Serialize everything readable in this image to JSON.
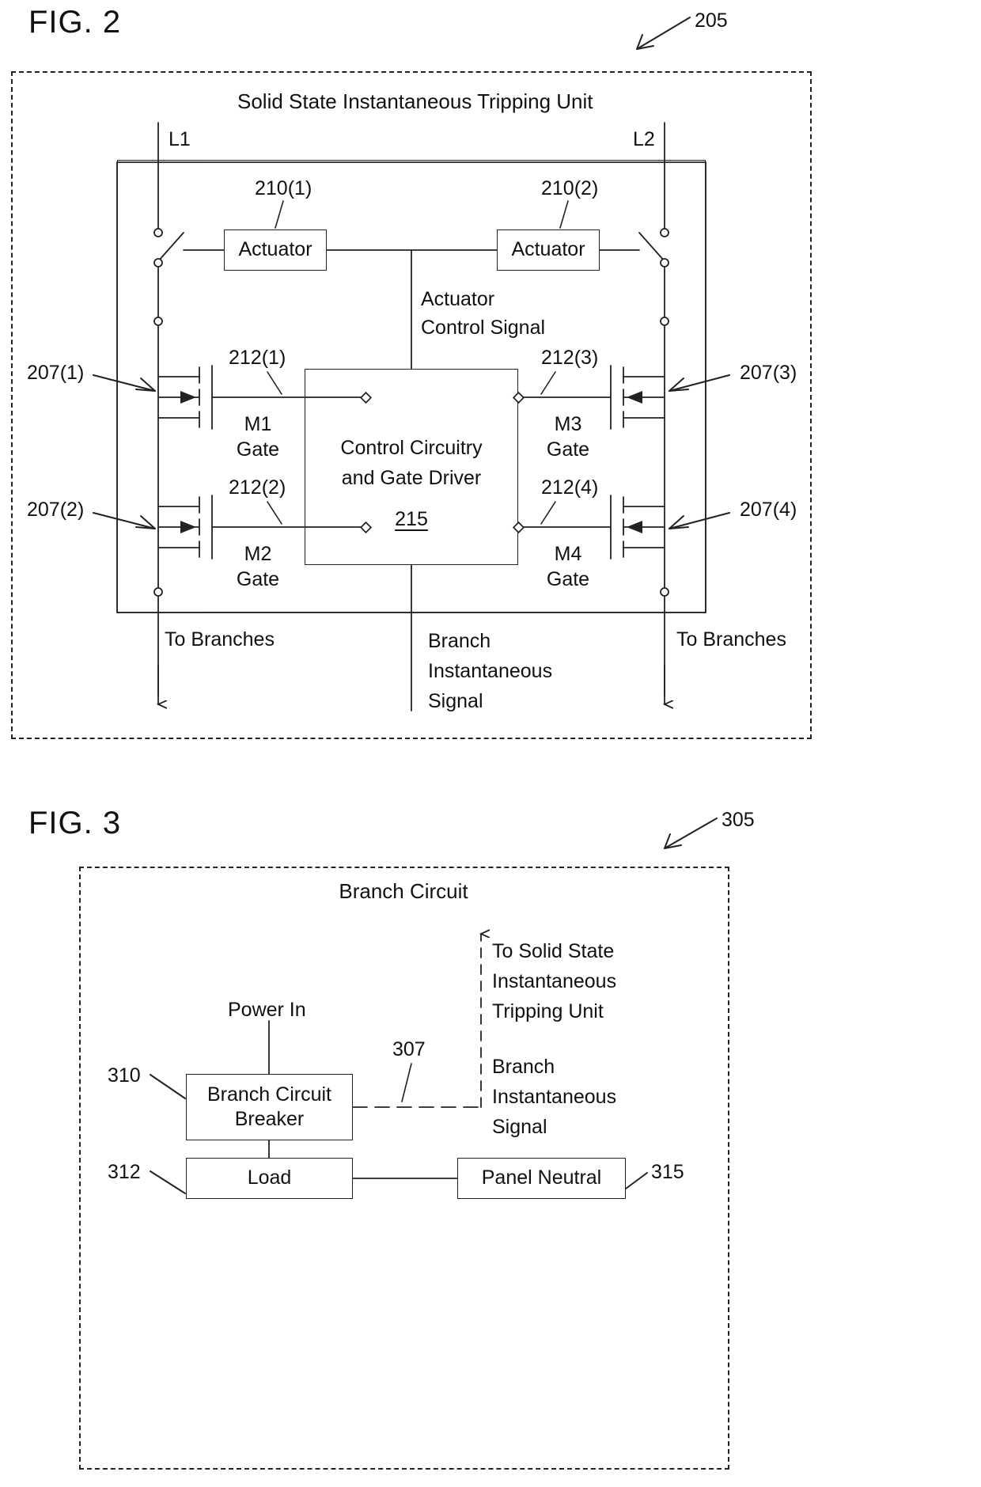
{
  "figures": [
    {
      "label": "FIG. 2",
      "ref_number": "205",
      "title": "Solid State Instantaneous Tripping Unit",
      "line_labels": {
        "left": "L1",
        "right": "L2"
      },
      "actuators": [
        {
          "ref": "210(1)",
          "label": "Actuator"
        },
        {
          "ref": "210(2)",
          "label": "Actuator"
        }
      ],
      "actuator_signal_label": "Actuator\nControl Signal",
      "control_block": {
        "line1": "Control Circuitry",
        "line2": "and Gate Driver",
        "ref": "215"
      },
      "mosfets": [
        {
          "ref": "207(1)",
          "gate_ref": "212(1)",
          "gate_label": "M1\nGate",
          "side": "left"
        },
        {
          "ref": "207(2)",
          "gate_ref": "212(2)",
          "gate_label": "M2\nGate",
          "side": "left"
        },
        {
          "ref": "207(3)",
          "gate_ref": "212(3)",
          "gate_label": "M3\nGate",
          "side": "right"
        },
        {
          "ref": "207(4)",
          "gate_ref": "212(4)",
          "gate_label": "M4\nGate",
          "side": "right"
        }
      ],
      "bottom_labels": {
        "left_branches": "To Branches",
        "right_branches": "To Branches",
        "branch_signal": "Branch\nInstantaneous\nSignal"
      }
    },
    {
      "label": "FIG. 3",
      "ref_number": "305",
      "title": "Branch Circuit",
      "power_in_label": "Power In",
      "to_unit_label": "To Solid State\nInstantaneous\nTripping Unit",
      "branch_signal_label": "Branch\nInstantaneous\nSignal",
      "signal_ref": "307",
      "blocks": [
        {
          "ref": "310",
          "label": "Branch Circuit\nBreaker"
        },
        {
          "ref": "312",
          "label": "Load"
        },
        {
          "ref": "315",
          "label": "Panel Neutral"
        }
      ]
    }
  ],
  "fig2": {
    "label": "FIG. 2",
    "ref": "205",
    "title": "Solid State Instantaneous Tripping Unit",
    "l1": "L1",
    "l2": "L2",
    "ref_210_1": "210(1)",
    "ref_210_2": "210(2)",
    "actuator1": "Actuator",
    "actuator2": "Actuator",
    "actuator_signal_l1": "Actuator",
    "actuator_signal_l2": "Control Signal",
    "ref_212_1": "212(1)",
    "ref_212_2": "212(2)",
    "ref_212_3": "212(3)",
    "ref_212_4": "212(4)",
    "ref_207_1": "207(1)",
    "ref_207_2": "207(2)",
    "ref_207_3": "207(3)",
    "ref_207_4": "207(4)",
    "m1_gate_a": "M1",
    "m1_gate_b": "Gate",
    "m2_gate_a": "M2",
    "m2_gate_b": "Gate",
    "m3_gate_a": "M3",
    "m3_gate_b": "Gate",
    "m4_gate_a": "M4",
    "m4_gate_b": "Gate",
    "control_l1": "Control Circuitry",
    "control_l2": "and Gate Driver",
    "control_ref": "215",
    "to_branches_left": "To Branches",
    "to_branches_right": "To Branches",
    "branch_sig_l1": "Branch",
    "branch_sig_l2": "Instantaneous",
    "branch_sig_l3": "Signal"
  },
  "fig3": {
    "label": "FIG. 3",
    "ref": "305",
    "title": "Branch Circuit",
    "power_in": "Power In",
    "to_unit_l1": "To Solid State",
    "to_unit_l2": "Instantaneous",
    "to_unit_l3": "Tripping Unit",
    "branch_sig_l1": "Branch",
    "branch_sig_l2": "Instantaneous",
    "branch_sig_l3": "Signal",
    "ref_307": "307",
    "ref_310": "310",
    "ref_312": "312",
    "ref_315": "315",
    "breaker_l1": "Branch Circuit",
    "breaker_l2": "Breaker",
    "load": "Load",
    "panel_neutral": "Panel Neutral"
  },
  "colors": {
    "ink": "#1a1a1a",
    "background": "#ffffff"
  }
}
